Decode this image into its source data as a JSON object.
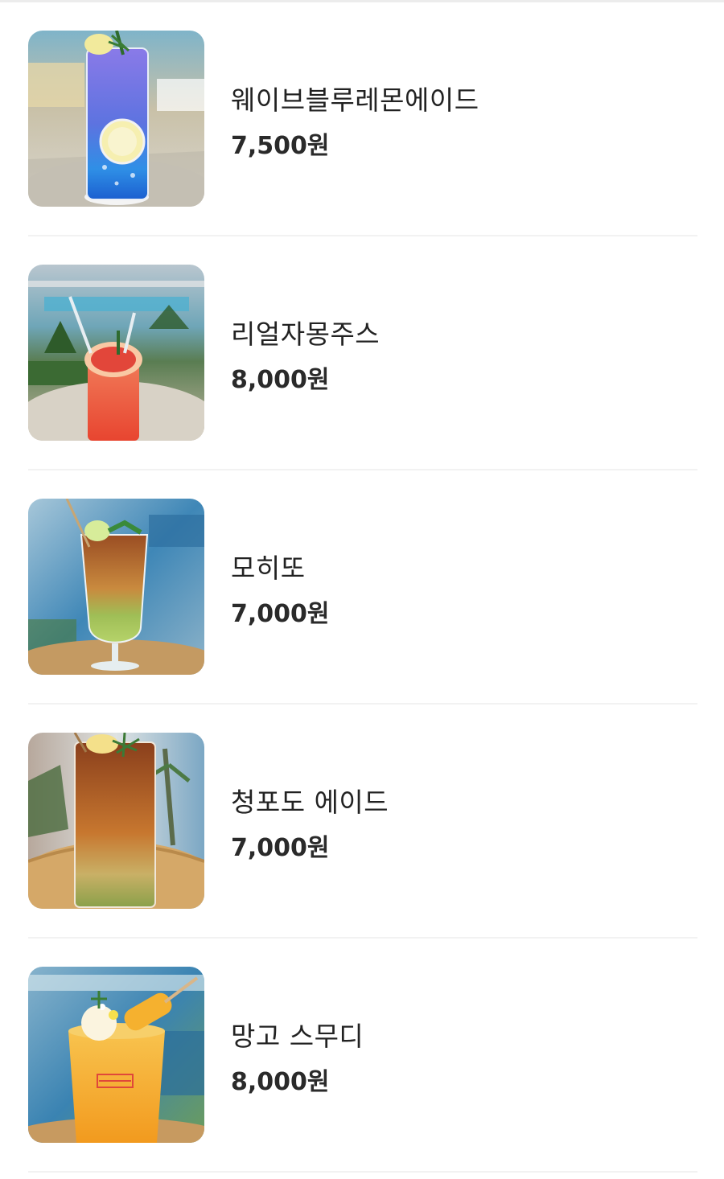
{
  "menu": {
    "items": [
      {
        "name": "웨이브블루레몬에이드",
        "price": "7,500원",
        "image_icon": "blue-lemonade-drink-photo"
      },
      {
        "name": "리얼자몽주스",
        "price": "8,000원",
        "image_icon": "grapefruit-juice-drink-photo"
      },
      {
        "name": "모히또",
        "price": "7,000원",
        "image_icon": "mojito-drink-photo"
      },
      {
        "name": "청포도 에이드",
        "price": "7,000원",
        "image_icon": "green-grape-ade-drink-photo"
      },
      {
        "name": "망고 스무디",
        "price": "8,000원",
        "image_icon": "mango-smoothie-drink-photo"
      }
    ]
  },
  "colors": {
    "divider": "#f2f2f2",
    "text": "#222222"
  }
}
